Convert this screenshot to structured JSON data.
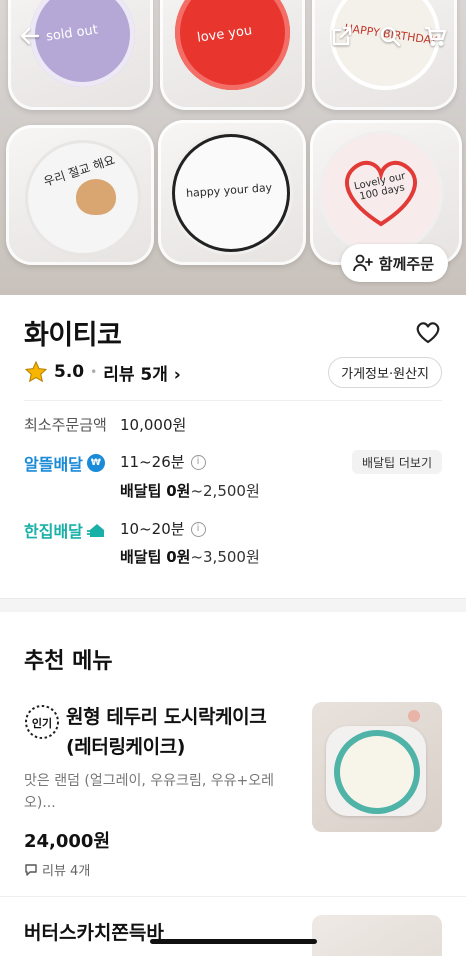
{
  "hero": {
    "together_order_label": "함께주문",
    "cakes": [
      {
        "text": "sold out",
        "color": "#b5a8d6"
      },
      {
        "text": "love you",
        "color": "#e8352e"
      },
      {
        "text": "HAPPY BIRTHDAY",
        "color": "#f4f0ea"
      },
      {
        "text": "우리 절교 해요",
        "color": "#f5f5f5"
      },
      {
        "text": "happy your day",
        "color": "#fafafa"
      },
      {
        "text": "Lovely our 100 days",
        "color": "#f7eceb"
      }
    ]
  },
  "store": {
    "name": "화이티코",
    "rating": "5.0",
    "review_label": "리뷰 5개",
    "info_button": "가게정보·원산지",
    "min_order_label": "최소주문금액",
    "min_order_value": "10,000원",
    "delivery1": {
      "label": "알뜰배달",
      "time": "11~26분",
      "tip_prefix": "배달팁",
      "tip_bold": "0원",
      "tip_rest": "~2,500원",
      "tip_more": "배달팁 더보기"
    },
    "delivery2": {
      "label": "한집배달",
      "time": "10~20분",
      "tip_prefix": "배달팁",
      "tip_bold": "0원",
      "tip_rest": "~3,500원"
    }
  },
  "recommended": {
    "title": "추천 메뉴",
    "items": [
      {
        "badge": "인기",
        "name": "원형 테두리 도시락케이크 (레터링케이크)",
        "desc": "맛은 랜덤 (얼그레이, 우유크림, 우유+오레오)...",
        "price": "24,000원",
        "review": "리뷰 4개"
      },
      {
        "name": "버터스카치쫀득바"
      }
    ]
  },
  "colors": {
    "accent_blue": "#1a8bd8",
    "accent_teal": "#19b0a8",
    "star": "#f7b500"
  }
}
